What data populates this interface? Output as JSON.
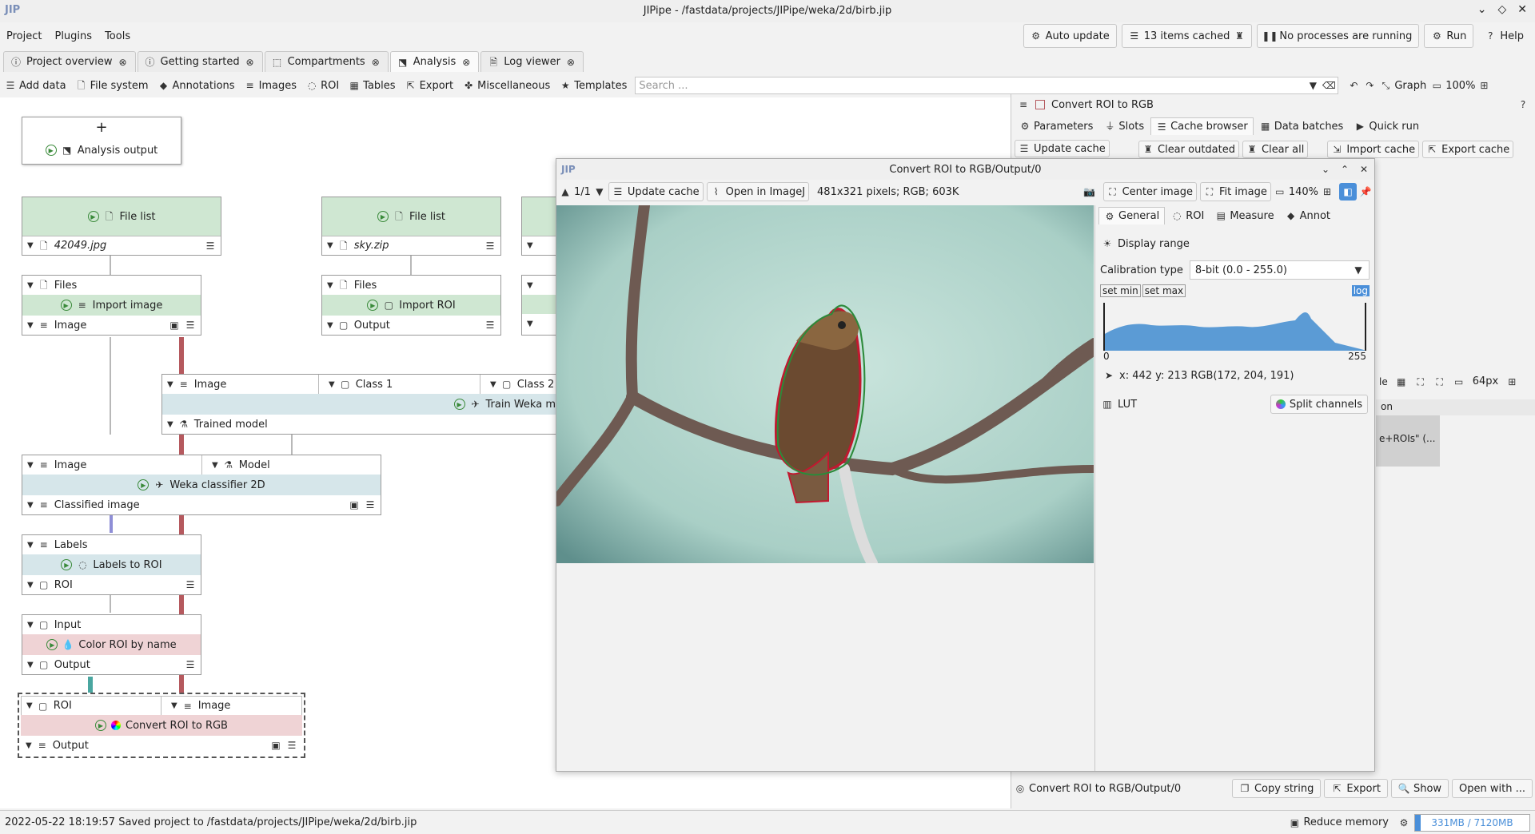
{
  "window": {
    "title": "JIPipe - /fastdata/projects/JIPipe/weka/2d/birb.jip",
    "logo": "JIP"
  },
  "menu": [
    "Project",
    "Plugins",
    "Tools"
  ],
  "top_buttons": {
    "auto_update": "Auto update",
    "cached": "13 items cached",
    "processes": "No processes are running",
    "run": "Run",
    "help": "Help"
  },
  "tabs": [
    {
      "label": "Project overview"
    },
    {
      "label": "Getting started"
    },
    {
      "label": "Compartments"
    },
    {
      "label": "Analysis"
    },
    {
      "label": "Log viewer"
    }
  ],
  "toolbar": {
    "items": [
      "Add data",
      "File system",
      "Annotations",
      "Images",
      "ROI",
      "Tables",
      "Export",
      "Miscellaneous",
      "Templates"
    ],
    "search_placeholder": "Search ...",
    "graph": "Graph",
    "zoom": "100%"
  },
  "nodes": {
    "analysis_output": {
      "label": "Analysis output"
    },
    "file1": {
      "title": "File list",
      "value": "42049.jpg"
    },
    "file2": {
      "title": "File list",
      "value": "sky.zip"
    },
    "import_image": {
      "in": "Files",
      "title": "Import image",
      "out": "Image"
    },
    "import_roi": {
      "in": "Files",
      "title": "Import ROI",
      "out": "Output"
    },
    "train": {
      "in1": "Image",
      "in2": "Class 1",
      "in3": "Class 2",
      "title": "Train Weka m",
      "out": "Trained model"
    },
    "classifier": {
      "in1": "Image",
      "in2": "Model",
      "title": "Weka classifier 2D",
      "out": "Classified image"
    },
    "labels": {
      "in": "Labels",
      "title": "Labels to ROI",
      "out": "ROI"
    },
    "color_roi": {
      "in": "Input",
      "title": "Color ROI by name",
      "out": "Output"
    },
    "convert": {
      "in1": "ROI",
      "in2": "Image",
      "title": "Convert ROI to RGB",
      "out": "Output"
    }
  },
  "right_panel": {
    "title": "Convert ROI to RGB",
    "tabs": [
      "Parameters",
      "Slots",
      "Cache browser",
      "Data batches",
      "Quick run"
    ],
    "cache_buttons": [
      "Update cache",
      "Clear outdated",
      "Clear all",
      "Import cache",
      "Export cache"
    ],
    "px": "64px",
    "col_header": "on",
    "cell": "e+ROIs\" (...",
    "footer_label": "Convert ROI to RGB/Output/0",
    "footer_buttons": [
      "Copy string",
      "Export",
      "Show",
      "Open with ..."
    ]
  },
  "viewer": {
    "title": "Convert ROI to RGB/Output/0",
    "page": "1/1",
    "update_cache": "Update cache",
    "open_imagej": "Open in ImageJ",
    "info": "481x321 pixels; RGB; 603K",
    "center": "Center image",
    "fit": "Fit image",
    "zoom": "140%",
    "tabs": [
      "General",
      "ROI",
      "Measure",
      "Annot"
    ],
    "display_range": "Display range",
    "calib_label": "Calibration type",
    "calib_value": "8-bit (0.0 - 255.0)",
    "set_min": "set min",
    "set_max": "set max",
    "log": "log",
    "hist_min": "0",
    "hist_max": "255",
    "pixel_info": "x: 442 y: 213 RGB(172, 204, 191)",
    "lut": "LUT",
    "split": "Split channels"
  },
  "status": {
    "message": "2022-05-22 18:19:57 Saved project to /fastdata/projects/JIPipe/weka/2d/birb.jip",
    "reduce": "Reduce memory",
    "memory": "331MB / 7120MB"
  },
  "colors": {
    "accent": "#4a8fd9",
    "node_green": "#cfe7d2",
    "node_blue": "#d6e6ea",
    "node_pink": "#efd3d5",
    "edge_red": "#b5595e",
    "edge_gray": "#b8b8b8",
    "edge_teal": "#4aa6a0"
  }
}
